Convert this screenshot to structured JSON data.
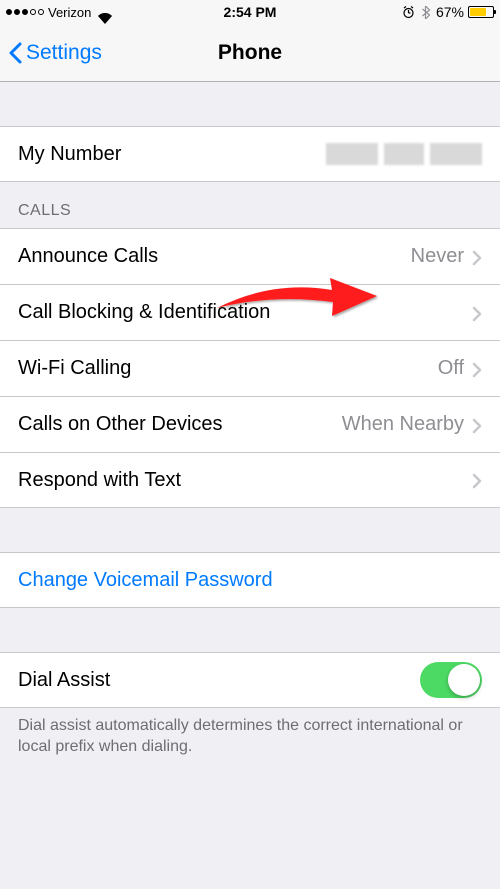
{
  "statusBar": {
    "carrier": "Verizon",
    "time": "2:54 PM",
    "batteryPct": "67%"
  },
  "nav": {
    "back": "Settings",
    "title": "Phone"
  },
  "myNumber": {
    "label": "My Number"
  },
  "sections": {
    "callsHeader": "CALLS"
  },
  "calls": {
    "announce": {
      "label": "Announce Calls",
      "value": "Never"
    },
    "blocking": {
      "label": "Call Blocking & Identification"
    },
    "wifi": {
      "label": "Wi-Fi Calling",
      "value": "Off"
    },
    "other": {
      "label": "Calls on Other Devices",
      "value": "When Nearby"
    },
    "respond": {
      "label": "Respond with Text"
    }
  },
  "voicemail": {
    "label": "Change Voicemail Password"
  },
  "dialAssist": {
    "label": "Dial Assist",
    "footer": "Dial assist automatically determines the correct international or local prefix when dialing."
  }
}
